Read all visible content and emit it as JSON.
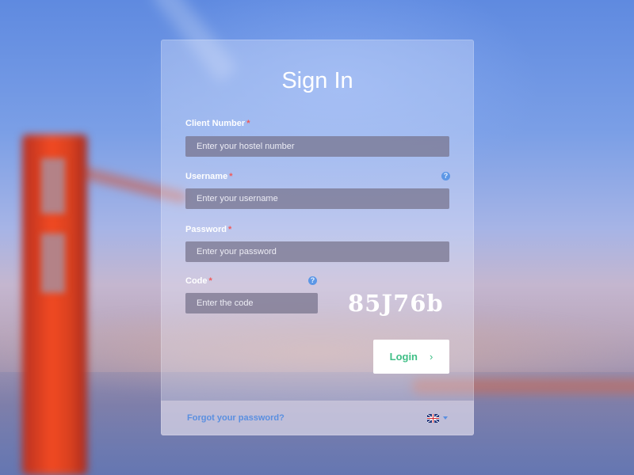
{
  "form": {
    "title": "Sign In",
    "required_marker": "*",
    "help_glyph": "?",
    "client_number": {
      "label": "Client Number",
      "placeholder": "Enter your hostel number",
      "value": ""
    },
    "username": {
      "label": "Username",
      "placeholder": "Enter your username",
      "value": ""
    },
    "password": {
      "label": "Password",
      "placeholder": "Enter your password",
      "value": ""
    },
    "code": {
      "label": "Code",
      "placeholder": "Enter the code",
      "value": ""
    },
    "captcha_text": "85J76b",
    "login_label": "Login",
    "login_chevron": "›"
  },
  "footer": {
    "forgot_label": "Forgot your password?",
    "language_icon": "uk-flag-icon",
    "language_dropdown_icon": "caret-down-icon"
  },
  "colors": {
    "accent_green": "#3fbf86",
    "link_blue": "#5a8fe0",
    "required_red": "#f05a5a",
    "help_blue": "#5c97e6"
  }
}
